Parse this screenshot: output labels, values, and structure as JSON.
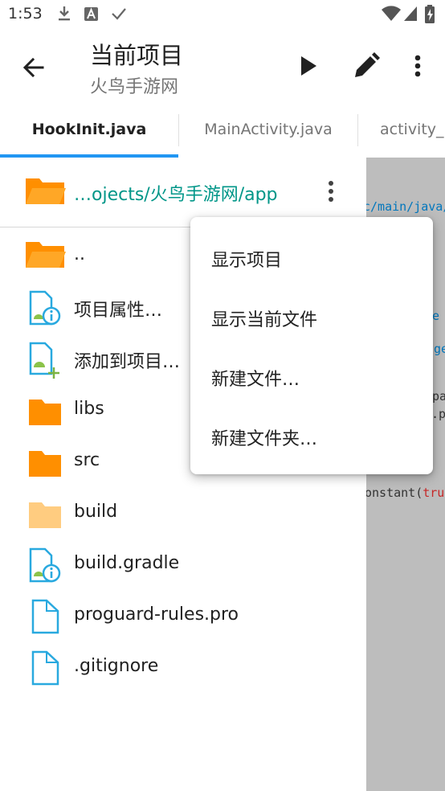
{
  "status_bar": {
    "time": "1:53"
  },
  "app_bar": {
    "title": "当前项目",
    "subtitle": "火鸟手游网"
  },
  "tabs": [
    {
      "label": "HookInit.java",
      "active": true
    },
    {
      "label": "MainActivity.java",
      "active": false
    },
    {
      "label": "activity_",
      "active": false
    }
  ],
  "drawer": {
    "path": "…ojects/火鸟手游网/app",
    "items": [
      {
        "label": "..",
        "icon": "folder-open-icon"
      },
      {
        "label": "项目属性…",
        "icon": "project-info-icon"
      },
      {
        "label": "添加到项目…",
        "icon": "add-to-project-icon"
      },
      {
        "label": "libs",
        "icon": "folder-icon"
      },
      {
        "label": "src",
        "icon": "folder-icon"
      },
      {
        "label": "build",
        "icon": "folder-light-icon"
      },
      {
        "label": "build.gradle",
        "icon": "gradle-file-icon"
      },
      {
        "label": "proguard-rules.pro",
        "icon": "file-icon"
      },
      {
        "label": ".gitignore",
        "icon": "file-icon"
      }
    ]
  },
  "editor_fragments": {
    "line1": "c/main/java/",
    "line2": "e",
    "line3": "ge",
    "line4": "pa",
    "line5": "o.p",
    "line6a": "onstant(",
    "line6b": "tru"
  },
  "menu": {
    "items": [
      "显示项目",
      "显示当前文件",
      "新建文件…",
      "新建文件夹…"
    ]
  },
  "colors": {
    "accent": "#2196f3",
    "path_text": "#009688",
    "folder": "#ff8f00",
    "folder_light": "#ffcc80",
    "file_outline": "#29a9df",
    "android_green": "#8bc34a"
  }
}
